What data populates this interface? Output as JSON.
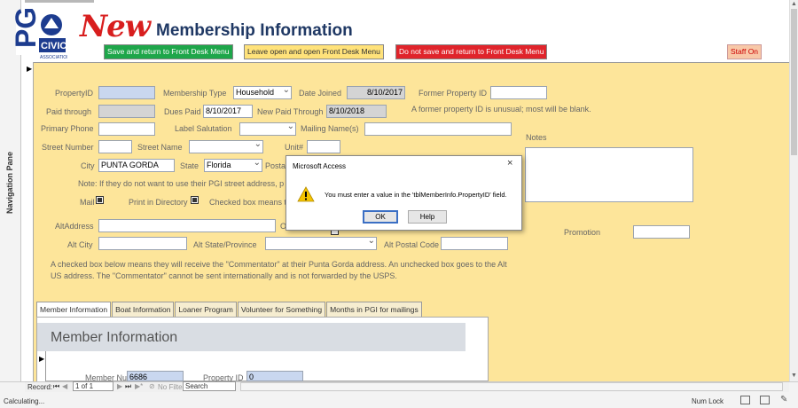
{
  "nav_pane": {
    "label": "Navigation Pane"
  },
  "header": {
    "logo_text": "PGI",
    "logo_sub": "CIVIC",
    "logo_sub2": "ASSOCIATION",
    "new_label": "New",
    "title": "Membership Information",
    "buttons": {
      "save": "Save and return to Front Desk Menu",
      "open": "Leave open and open Front Desk Menu",
      "nosave": "Do not save and return to Front Desk Menu",
      "staff": "Staff On"
    }
  },
  "form": {
    "property_id_label": "PropertyID",
    "property_id_value": "",
    "membership_type_label": "Membership Type",
    "membership_type_value": "Household",
    "date_joined_label": "Date Joined",
    "date_joined_value": "8/10/2017",
    "former_property_label": "Former Property ID",
    "former_property_value": "",
    "former_property_note": "A former property ID is unusual; most will be blank.",
    "paid_through_label": "Paid through",
    "paid_through_value": "",
    "dues_paid_label": "Dues Paid",
    "dues_paid_value": "8/10/2017",
    "new_paid_through_label": "New Paid Through",
    "new_paid_through_value": "8/10/2018",
    "primary_phone_label": "Primary Phone",
    "primary_phone_value": "",
    "label_salutation_label": "Label Salutation",
    "label_salutation_value": "",
    "mailing_names_label": "Mailing Name(s)",
    "mailing_names_value": "",
    "notes_label": "Notes",
    "notes_value": "",
    "street_number_label": "Street Number",
    "street_number_value": "",
    "street_name_label": "Street Name",
    "street_name_value": "",
    "unit_label": "Unit#",
    "unit_value": "",
    "city_label": "City",
    "city_value": "PUNTA GORDA",
    "state_label": "State",
    "state_value": "Florida",
    "postal_label": "Postal",
    "note_text": "Note: If they do not want to use their PGI street address, p",
    "mail_label": "Mail",
    "print_dir_label": "Print in Directory",
    "checked_box_text": "Checked box means t",
    "alt_address_label": "AltAddress",
    "alt_address_value": "",
    "alt_city_label": "Alt City",
    "alt_city_value": "",
    "alt_state_label": "Alt State/Province",
    "alt_state_value": "",
    "alt_postal_label": "Alt Postal Code",
    "alt_postal_value": "",
    "promotion_label": "Promotion",
    "promotion_value": "",
    "o_label": "O",
    "commentator_note": "A checked box below means they will receive the \"Commentator\" at their Punta Gorda address. An unchecked box goes to the Alt US address. The \"Commentator\" cannot be sent internationally and is not forwarded by the USPS."
  },
  "tabs": [
    {
      "label": "Member Information"
    },
    {
      "label": "Boat Information"
    },
    {
      "label": "Loaner Program"
    },
    {
      "label": "Volunteer for Something"
    },
    {
      "label": "Months in PGI for mailings"
    }
  ],
  "subform": {
    "title": "Member Information",
    "member_number_label": "Member Number",
    "member_number_value": "6686",
    "property_id_label": "Property ID",
    "property_id_value": "0"
  },
  "record_bar": {
    "record_label": "Record:",
    "position": "1 of 1",
    "filter_label": "No Filter",
    "search_label": "Search"
  },
  "status_bar": {
    "left_text": "Calculating...",
    "num_lock": "Num Lock"
  },
  "dialog": {
    "title": "Microsoft Access",
    "message": "You must enter a value in the 'tblMemberInfo.PropertyID' field.",
    "ok_label": "OK",
    "help_label": "Help",
    "close_label": "×"
  }
}
